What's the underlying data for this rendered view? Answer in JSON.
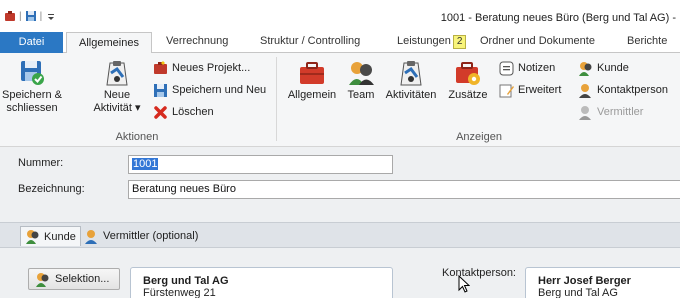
{
  "window": {
    "title": "1001 - Beratung neues Büro (Berg und Tal AG) -"
  },
  "quick_access": [
    "app-icon",
    "save-icon",
    "customize-qat"
  ],
  "ribbon_tabs": {
    "file": "Datei",
    "allgemeines": "Allgemeines",
    "verrechnung": "Verrechnung",
    "struktur": "Struktur / Controlling",
    "leistungen": "Leistungen",
    "leistungen_keytip": "2",
    "ordner": "Ordner und Dokumente",
    "berichte": "Berichte"
  },
  "groups": {
    "aktionen": {
      "label": "Aktionen",
      "speichern_line1": "Speichern &",
      "speichern_line2": "schliessen",
      "neue_line1": "Neue",
      "neue_line2": "Aktivität ▾",
      "neues_projekt": "Neues Projekt...",
      "speichern_neu": "Speichern und Neu",
      "loeschen": "Löschen"
    },
    "anzeigen": {
      "label": "Anzeigen",
      "allgemein": "Allgemein",
      "team": "Team",
      "aktivitaeten": "Aktivitäten",
      "zusaetze": "Zusätze",
      "notizen": "Notizen",
      "erweitert": "Erweitert",
      "kunde": "Kunde",
      "kontaktperson": "Kontaktperson",
      "vermittler": "Vermittler"
    }
  },
  "form": {
    "nummer_label": "Nummer:",
    "nummer_value": "1001",
    "bezeichnung_label": "Bezeichnung:",
    "bezeichnung_value": "Beratung neues Büro"
  },
  "subtabs": {
    "kunde": "Kunde",
    "vermittler": "Vermittler (optional)"
  },
  "kunde_panel": {
    "selektion": "Selektion...",
    "customer_name": "Berg und Tal AG",
    "customer_street": "Fürstenweg 21",
    "kontakt_label": "Kontaktperson:",
    "kontakt_name": "Herr Josef Berger",
    "kontakt_company": "Berg und Tal AG"
  },
  "colors": {
    "file_tab": "#2b78c4",
    "ribbon_bg": "#f5f6f7",
    "selection": "#3377d6",
    "keytip": "#f8f47a"
  }
}
